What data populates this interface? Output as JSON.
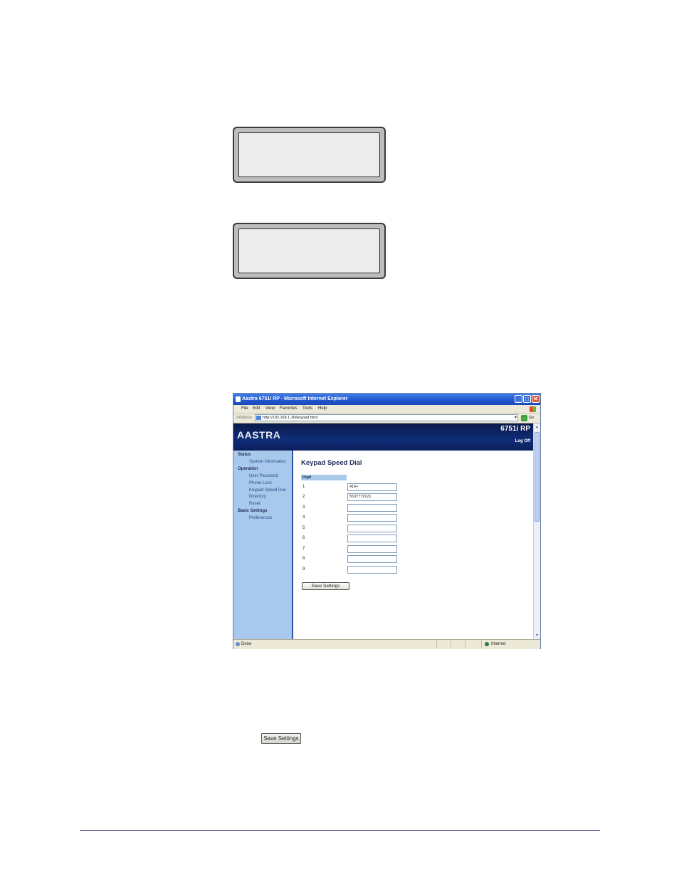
{
  "browser": {
    "title": "Aastra 6751i RP - Microsoft Internet Explorer",
    "min_glyph": "_",
    "max_glyph": "□",
    "close_glyph": "✕",
    "menu": [
      "File",
      "Edit",
      "View",
      "Favorites",
      "Tools",
      "Help"
    ],
    "address_label": "Address",
    "address_url": "http://192.168.1.36/keypad.html",
    "go_label": "Go",
    "status_text": "Done",
    "zone_text": "Internet"
  },
  "web_ui": {
    "logo": "AASTRA",
    "model": "6751i RP",
    "log_off": "Log Off",
    "sidebar": [
      {
        "section": "Status",
        "items": [
          "System Information"
        ]
      },
      {
        "section": "Operation",
        "items": [
          "User Password",
          "Phone Lock",
          "Keypad Speed Dial",
          "Directory",
          "Reset"
        ]
      },
      {
        "section": "Basic Settings",
        "items": [
          "Preferences"
        ]
      }
    ],
    "page_title": "Keypad Speed Dial",
    "table_header": "Digit",
    "rows": [
      {
        "digit": "1",
        "value": "416+"
      },
      {
        "digit": "2",
        "value": "5537779121"
      },
      {
        "digit": "3",
        "value": ""
      },
      {
        "digit": "4",
        "value": ""
      },
      {
        "digit": "5",
        "value": ""
      },
      {
        "digit": "6",
        "value": ""
      },
      {
        "digit": "7",
        "value": ""
      },
      {
        "digit": "8",
        "value": ""
      },
      {
        "digit": "9",
        "value": ""
      }
    ],
    "save_button": "Save Settings"
  },
  "standalone_button": "Save Settings"
}
